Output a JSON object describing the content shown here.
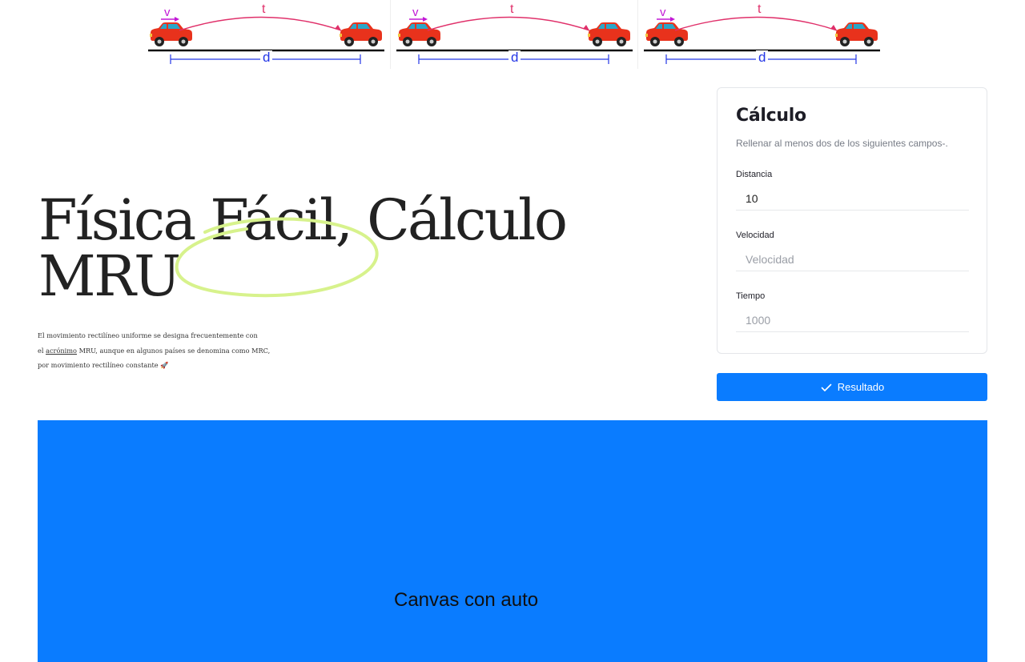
{
  "diagram": {
    "velocity_label": "v",
    "time_label": "t",
    "distance_label": "d",
    "panel_count": 3,
    "colors": {
      "velocity": "#c218d6",
      "time": "#e0306a",
      "distance": "#2336e6",
      "car": "#e8321c",
      "window": "#2aa6c8",
      "ground": "#111111"
    }
  },
  "hero": {
    "title_line1": "Física Fácil, Cálculo",
    "title_line2": "MRU",
    "desc_line1": "El movimiento rectilíneo uniforme se designa frecuentemente con",
    "desc_line2_before": "el ",
    "desc_line2_link": "acrónimo",
    "desc_line2_after": " MRU, aunque en algunos países se denomina como MRC,",
    "desc_line3": "por movimiento rectilíneo constante 🚀",
    "scribble_color": "#d7f28c"
  },
  "calc": {
    "title": "Cálculo",
    "subtitle": "Rellenar al menos dos de los siguientes campos-.",
    "distance": {
      "label": "Distancia",
      "value": "10",
      "placeholder": "Distancia"
    },
    "velocity": {
      "label": "Velocidad",
      "value": "",
      "placeholder": "Velocidad"
    },
    "time": {
      "label": "Tiempo",
      "value": "",
      "placeholder": "1000"
    }
  },
  "result_button": {
    "label": "Resultado",
    "icon": "check-icon"
  },
  "canvas": {
    "label": "Canvas con auto",
    "background": "#0a7cff"
  }
}
